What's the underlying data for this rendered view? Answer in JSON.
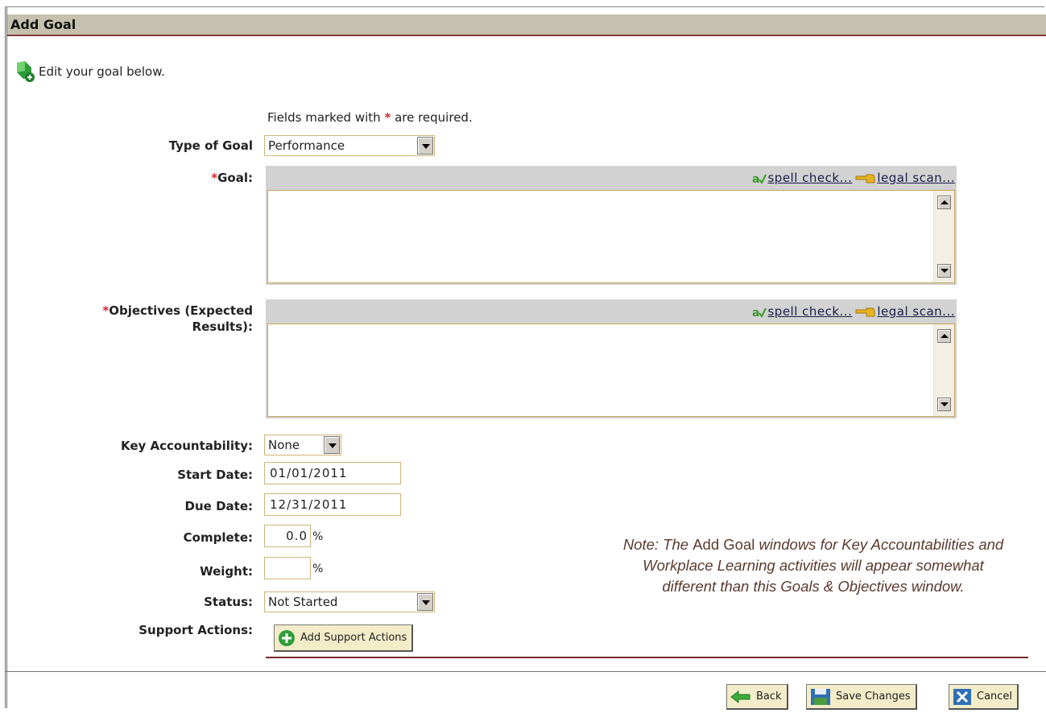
{
  "window": {
    "title": "Add Goal"
  },
  "intro": {
    "text": "Edit your goal below."
  },
  "form": {
    "required_prefix": "Fields marked with ",
    "required_star": "*",
    "required_suffix": " are required.",
    "type_of_goal": {
      "label": "Type of Goal",
      "value": "Performance"
    },
    "goal": {
      "star": "*",
      "label": "Goal:",
      "value": ""
    },
    "objectives": {
      "star": "*",
      "label_line1": "Objectives (Expected",
      "label_line2": "Results):",
      "value": ""
    },
    "key_accountability": {
      "label": "Key Accountability:",
      "value": "None"
    },
    "start_date": {
      "label": "Start Date:",
      "value": "01/01/2011"
    },
    "due_date": {
      "label": "Due Date:",
      "value": "12/31/2011"
    },
    "complete": {
      "label": "Complete:",
      "value": "0.0",
      "unit": "%"
    },
    "weight": {
      "label": "Weight:",
      "value": "",
      "unit": "%"
    },
    "status": {
      "label": "Status:",
      "value": "Not Started"
    },
    "support_actions": {
      "label": "Support Actions:",
      "button": "Add Support Actions"
    }
  },
  "editor_tools": {
    "spell_check": "spell check...",
    "legal_scan": "legal scan..."
  },
  "note": {
    "part1": "Note: The ",
    "part2": "Add Goal",
    "part3": " windows for Key Accountabilities and Workplace Learning activities will appear somewhat different than this Goals & Objectives window."
  },
  "footer": {
    "back": "Back",
    "save": "Save Changes",
    "cancel": "Cancel"
  },
  "colors": {
    "title_bar": "#c6c0ae",
    "accent_line": "#7a2a2a",
    "required": "#e0242a",
    "button_bg": "#f3ecc8"
  }
}
